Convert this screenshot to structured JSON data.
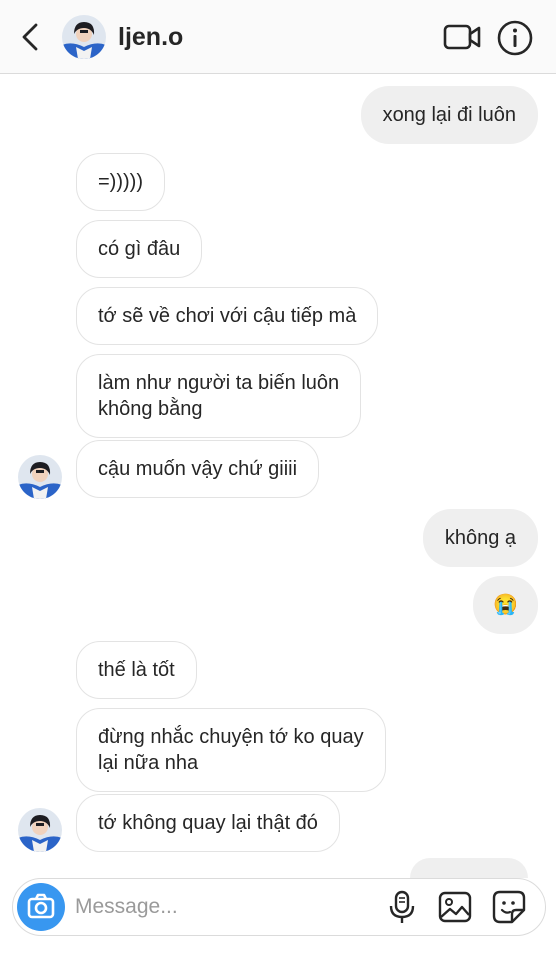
{
  "header": {
    "username": "ljen.o",
    "back_icon": "chevron-left-icon",
    "video_icon": "video-camera-icon",
    "info_icon": "info-icon"
  },
  "messages": [
    {
      "side": "outgoing",
      "text": "xong lại đi luôn"
    },
    {
      "side": "incoming",
      "text": "=)))))"
    },
    {
      "side": "incoming",
      "text": "có gì đâu"
    },
    {
      "side": "incoming",
      "text": "tớ sẽ về chơi với cậu tiếp mà"
    },
    {
      "side": "incoming",
      "lines": [
        "làm như người ta biến luôn",
        "không bằng"
      ]
    },
    {
      "side": "incoming",
      "text": "cậu muốn vậy chứ giiii"
    },
    {
      "side": "outgoing",
      "text": "không ạ"
    },
    {
      "side": "outgoing",
      "text": "😭"
    },
    {
      "side": "incoming",
      "text": "thế là tốt"
    },
    {
      "side": "incoming",
      "lines": [
        "đừng nhắc chuyện tớ ko quay",
        "lại nữa nha"
      ]
    },
    {
      "side": "incoming",
      "text": "tớ không quay lại thật đó"
    }
  ],
  "composer": {
    "placeholder": "Message...",
    "camera_icon": "camera-icon",
    "mic_icon": "microphone-icon",
    "gallery_icon": "gallery-icon",
    "sticker_icon": "sticker-icon"
  },
  "colors": {
    "accent": "#3897f0",
    "outgoing_bubble": "#efefef",
    "incoming_border": "#e3e3e3",
    "text": "#262626"
  }
}
